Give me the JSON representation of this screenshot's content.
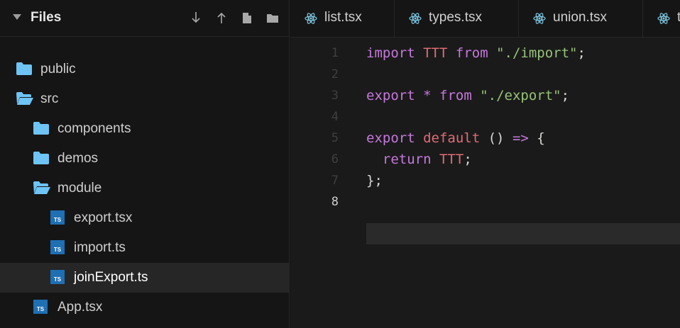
{
  "sidebar": {
    "title": "Files",
    "actions": [
      "download-icon",
      "upload-icon",
      "new-file-icon",
      "new-folder-icon"
    ],
    "tree": [
      {
        "label": "public",
        "type": "folder",
        "open": false,
        "depth": 0
      },
      {
        "label": "src",
        "type": "folder",
        "open": true,
        "depth": 0
      },
      {
        "label": "components",
        "type": "folder",
        "open": false,
        "depth": 1
      },
      {
        "label": "demos",
        "type": "folder",
        "open": false,
        "depth": 1
      },
      {
        "label": "module",
        "type": "folder",
        "open": true,
        "depth": 1
      },
      {
        "label": "export.tsx",
        "type": "ts-file",
        "depth": 2
      },
      {
        "label": "import.ts",
        "type": "ts-file",
        "depth": 2
      },
      {
        "label": "joinExport.ts",
        "type": "ts-file",
        "depth": 2,
        "active": true
      },
      {
        "label": "App.tsx",
        "type": "ts-file",
        "depth": 1
      }
    ]
  },
  "tabs": [
    {
      "label": "list.tsx",
      "icon": "react-icon"
    },
    {
      "label": "types.tsx",
      "icon": "react-icon"
    },
    {
      "label": "union.tsx",
      "icon": "react-icon"
    },
    {
      "label": "t",
      "icon": "react-icon"
    }
  ],
  "editor": {
    "current_line": 8,
    "lines": [
      {
        "n": "1",
        "tokens": [
          [
            "kw",
            "import"
          ],
          [
            "punc",
            " "
          ],
          [
            "ident",
            "TTT"
          ],
          [
            "punc",
            " "
          ],
          [
            "kw",
            "from"
          ],
          [
            "punc",
            " "
          ],
          [
            "str",
            "\"./import\""
          ],
          [
            "punc",
            ";"
          ]
        ]
      },
      {
        "n": "2",
        "tokens": []
      },
      {
        "n": "3",
        "tokens": [
          [
            "kw",
            "export"
          ],
          [
            "punc",
            " "
          ],
          [
            "op",
            "*"
          ],
          [
            "punc",
            " "
          ],
          [
            "kw",
            "from"
          ],
          [
            "punc",
            " "
          ],
          [
            "str",
            "\"./export\""
          ],
          [
            "punc",
            ";"
          ]
        ]
      },
      {
        "n": "4",
        "tokens": []
      },
      {
        "n": "5",
        "tokens": [
          [
            "kw",
            "export"
          ],
          [
            "punc",
            " "
          ],
          [
            "ident",
            "default"
          ],
          [
            "punc",
            " () "
          ],
          [
            "op",
            "=>"
          ],
          [
            "punc",
            " {"
          ]
        ]
      },
      {
        "n": "6",
        "tokens": [
          [
            "punc",
            "  "
          ],
          [
            "kw",
            "return"
          ],
          [
            "punc",
            " "
          ],
          [
            "ident",
            "TTT"
          ],
          [
            "punc",
            ";"
          ]
        ]
      },
      {
        "n": "7",
        "tokens": [
          [
            "punc",
            "};"
          ]
        ]
      },
      {
        "n": "8",
        "tokens": []
      }
    ]
  },
  "colors": {
    "keyword": "#c678dd",
    "identifier": "#e06c75",
    "string": "#98c379",
    "folder": "#6ec4f5",
    "ts_badge": "#1f6fb3",
    "active_row": "#262626"
  }
}
